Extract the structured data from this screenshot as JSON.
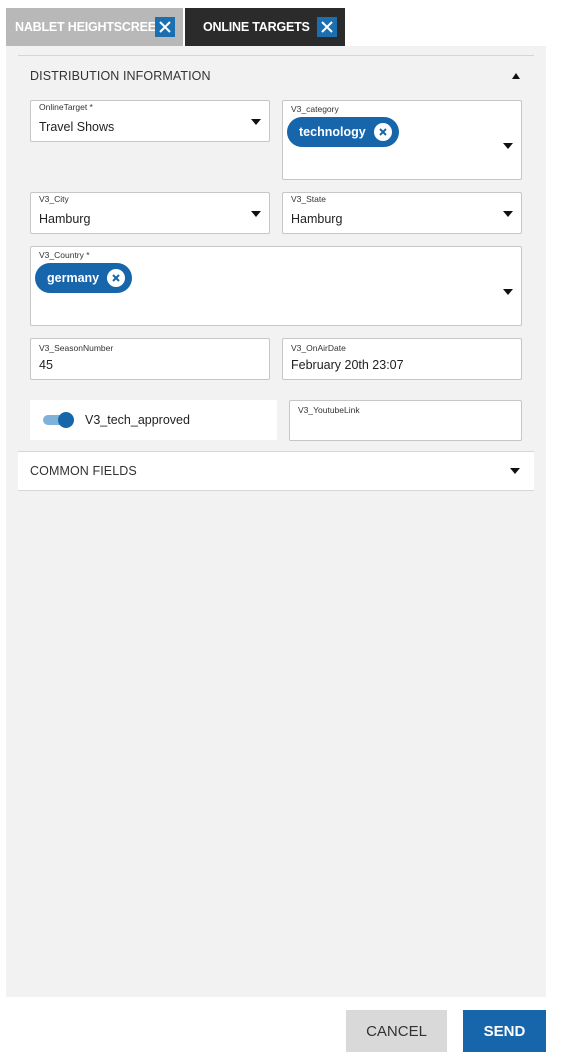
{
  "tabs": [
    {
      "label": "NABLET HEIGHTSCREEN"
    },
    {
      "label": "ONLINE TARGETS"
    }
  ],
  "sections": {
    "distribution": {
      "title": "DISTRIBUTION INFORMATION"
    },
    "common": {
      "title": "COMMON FIELDS"
    }
  },
  "fields": {
    "online_target": {
      "label": "OnlineTarget *",
      "value": "Travel Shows"
    },
    "category": {
      "label": "V3_category",
      "chips": [
        "technology"
      ]
    },
    "city": {
      "label": "V3_City",
      "value": "Hamburg"
    },
    "state": {
      "label": "V3_State",
      "value": "Hamburg"
    },
    "country": {
      "label": "V3_Country *",
      "chips": [
        "germany"
      ]
    },
    "season_number": {
      "label": "V3_SeasonNumber",
      "value": "45"
    },
    "on_air_date": {
      "label": "V3_OnAirDate",
      "value": "February 20th 23:07"
    },
    "tech_approved": {
      "label": "V3_tech_approved",
      "checked": true
    },
    "youtube_link": {
      "label": "V3_YoutubeLink",
      "value": ""
    }
  },
  "footer": {
    "cancel_label": "CANCEL",
    "send_label": "SEND"
  },
  "colors": {
    "accent": "#1766ab",
    "tab_inactive": "#b8b8b8",
    "tab_active": "#2b2b2b",
    "panel_bg": "#f2f2f2",
    "cancel_bg": "#d9d9d9"
  },
  "icons": [
    "close-icon",
    "chip-remove-icon",
    "caret-up-icon",
    "caret-down-icon"
  ]
}
